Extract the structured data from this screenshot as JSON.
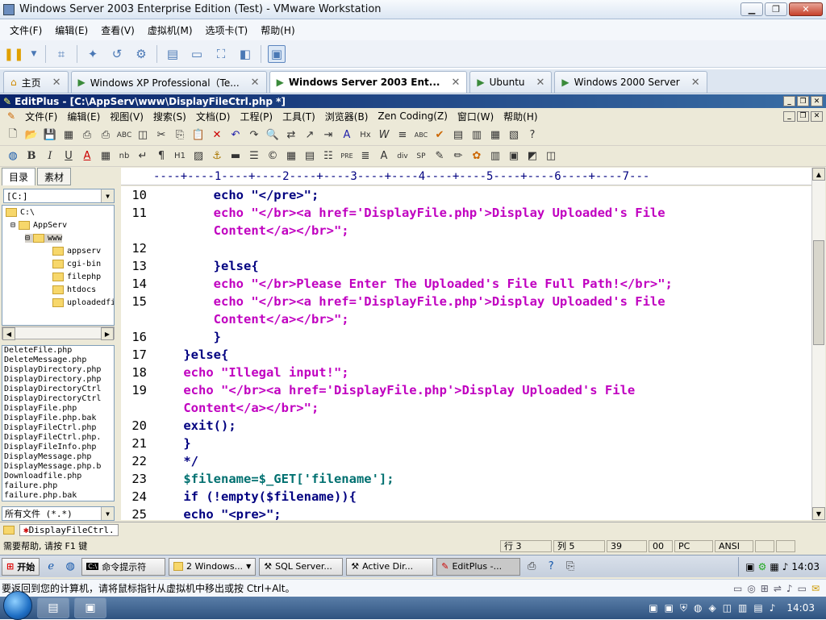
{
  "vmware": {
    "title": "Windows Server 2003 Enterprise Edition (Test) - VMware Workstation",
    "menu": [
      "文件(F)",
      "编辑(E)",
      "查看(V)",
      "虚拟机(M)",
      "选项卡(T)",
      "帮助(H)"
    ],
    "tabs": [
      {
        "label": "主页"
      },
      {
        "label": "Windows XP Professional（Te..."
      },
      {
        "label": "Windows Server 2003 Ent..."
      },
      {
        "label": "Ubuntu"
      },
      {
        "label": "Windows 2000 Server"
      }
    ]
  },
  "editplus": {
    "title": "EditPlus - [C:\\AppServ\\www\\DisplayFileCtrl.php *]",
    "menu": [
      "文件(F)",
      "编辑(E)",
      "视图(V)",
      "搜索(S)",
      "文档(D)",
      "工程(P)",
      "工具(T)",
      "浏览器(B)",
      "Zen Coding(Z)",
      "窗口(W)",
      "帮助(H)"
    ],
    "left_tabs": [
      "目录",
      "素材"
    ],
    "drive": "[C:]",
    "tree": [
      "C:\\",
      "AppServ",
      "www",
      "appserv",
      "cgi-bin",
      "filephp",
      "htdocs",
      "uploadedfi"
    ],
    "files": [
      "DeleteFile.php",
      "DeleteMessage.php",
      "DisplayDirectory.php",
      "DisplayDirectory.php",
      "DisplayDirectoryCtrl",
      "DisplayDirectoryCtrl",
      "DisplayFile.php",
      "DisplayFile.php.bak",
      "DisplayFileCtrl.php",
      "DisplayFileCtrl.php.",
      "DisplayFileInfo.php",
      "DisplayMessage.php",
      "DisplayMessage.php.b",
      "Downloadfile.php",
      "failure.php",
      "failure.php.bak"
    ],
    "filter": "所有文件 (*.*)",
    "ruler": "----+----1----+----2----+----3----+----4----+----5----+----6----+----7---",
    "code": [
      {
        "n": "10",
        "t": "        echo \"</pre>\";"
      },
      {
        "n": "11",
        "t": "        echo \"</br><a href='DisplayFile.php'>Display Uploaded's File"
      },
      {
        "n": "",
        "t": "        Content</a></br>\";"
      },
      {
        "n": "12",
        "t": ""
      },
      {
        "n": "13",
        "t": "        }else{"
      },
      {
        "n": "14",
        "t": "        echo \"</br>Please Enter The Uploaded's File Full Path!</br>\";"
      },
      {
        "n": "15",
        "t": "        echo \"</br><a href='DisplayFile.php'>Display Uploaded's File"
      },
      {
        "n": "",
        "t": "        Content</a></br>\";"
      },
      {
        "n": "16",
        "t": "        }"
      },
      {
        "n": "17",
        "t": "    }else{"
      },
      {
        "n": "18",
        "t": "    echo \"Illegal input!\";"
      },
      {
        "n": "19",
        "t": "    echo \"</br><a href='DisplayFile.php'>Display Uploaded's File"
      },
      {
        "n": "",
        "t": "    Content</a></br>\";"
      },
      {
        "n": "20",
        "t": "    exit();"
      },
      {
        "n": "21",
        "t": "    }"
      },
      {
        "n": "22",
        "t": "    */"
      },
      {
        "n": "23",
        "t": "    $filename=$_GET['filename'];"
      },
      {
        "n": "24",
        "t": "    if (!empty($filename)){"
      },
      {
        "n": "25",
        "t": "    echo \"<pre>\";"
      }
    ],
    "doc_tab": "DisplayFileCtrl.",
    "status": {
      "help": "需要帮助, 请按 F1 键",
      "row": "行 3",
      "col": "列 5",
      "n1": "39",
      "n2": "00",
      "mode": "PC",
      "enc": "ANSI"
    }
  },
  "xp_taskbar": {
    "start": "开始",
    "items": [
      "命令提示符",
      "2 Windows...",
      "SQL Server...",
      "Active Dir...",
      "EditPlus -..."
    ],
    "clock": "14:03"
  },
  "hint": "要返回到您的计算机，请将鼠标指针从虚拟机中移出或按 Ctrl+Alt。",
  "win7": {
    "clock": "14:03"
  }
}
